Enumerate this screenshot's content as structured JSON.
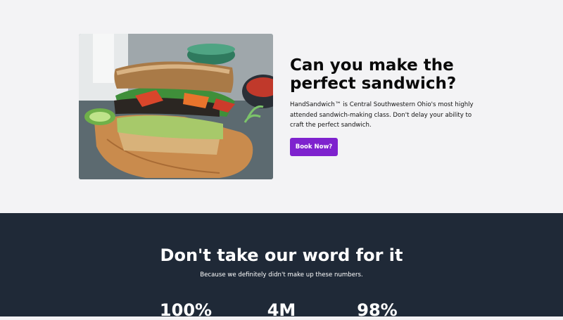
{
  "hero": {
    "title": "Can you make the perfect sandwich?",
    "description": "HandSandwich™ is Central Southwestern Ohio's most highly attended sandwich-making class. Don't delay your ability to craft the perfect sandwich.",
    "book_button_label": "Book Now?",
    "image_alt": "Sandwich on a wooden board"
  },
  "stats": {
    "title": "Don't take our word for it",
    "subtitle": "Because we definitely didn't make up these numbers.",
    "values": [
      "100%",
      "4M",
      "98%"
    ]
  },
  "colors": {
    "accent": "#7e22ce",
    "dark_section": "#1f2937",
    "page_background": "#f3f3f5"
  }
}
